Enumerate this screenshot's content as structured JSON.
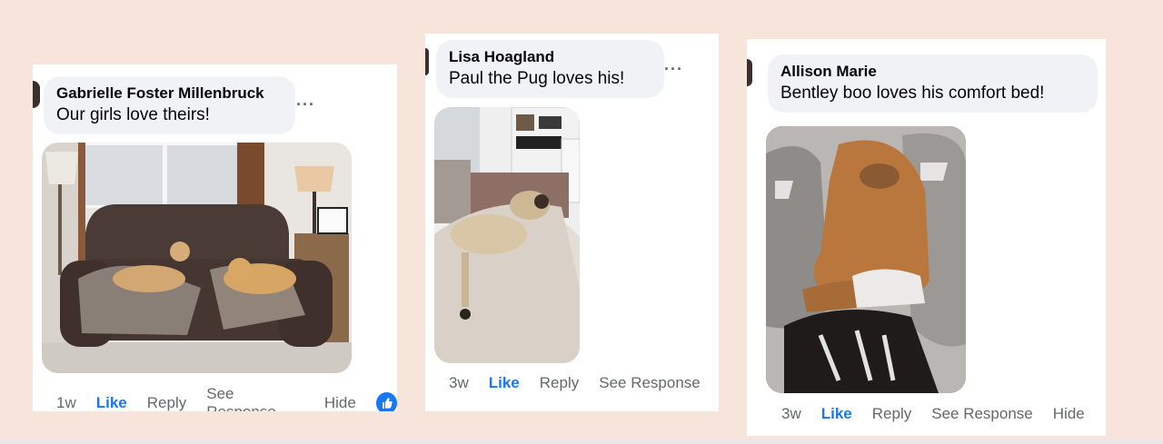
{
  "comments": [
    {
      "author": "Gabrielle Foster Millenbruck",
      "text": "Our girls love theirs!",
      "more": "···",
      "time": "1w",
      "like": "Like",
      "reply": "Reply",
      "see_response": "See Response",
      "hide": "Hide",
      "reaction_icon": "thumbs-up-icon",
      "photo": "two dogs on a brown leather sofa"
    },
    {
      "author": "Lisa Hoagland",
      "text": "Paul the Pug loves his!",
      "more": "···",
      "time": "3w",
      "like": "Like",
      "reply": "Reply",
      "see_response": "See Response",
      "photo": "pug asleep on a fluffy bed"
    },
    {
      "author": "Allison Marie",
      "text": "Bentley boo loves his comfort bed!",
      "time": "3w",
      "like": "Like",
      "reply": "Reply",
      "see_response": "See Response",
      "hide": "Hide",
      "photo": "brown dog sleeping on a faux fur bed"
    }
  ],
  "colors": {
    "background": "#f7e5dc",
    "bubble": "#f0f2f5",
    "like_blue": "#1877f2",
    "muted_text": "#65676b"
  }
}
